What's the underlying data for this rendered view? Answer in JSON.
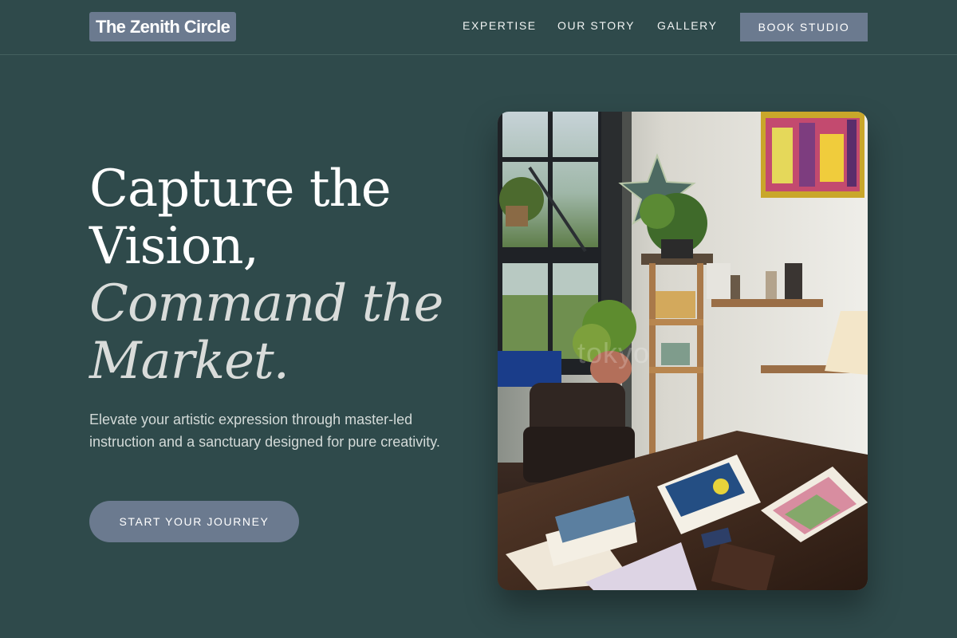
{
  "header": {
    "logo": "The Zenith Circle",
    "nav": [
      "EXPERTISE",
      "OUR STORY",
      "GALLERY"
    ],
    "cta": "BOOK STUDIO"
  },
  "hero": {
    "headline_lines": [
      "Capture the",
      "Vision,",
      "Command the",
      "Market."
    ],
    "subcopy": "Elevate your artistic expression through master-led instruction and a sanctuary designed for pure creativity.",
    "cta": "START YOUR JOURNEY"
  },
  "photo": {
    "watermark": "tokyo"
  },
  "colors": {
    "background": "#2f4a4b",
    "accent": "#6b7a8f",
    "text": "#ffffff"
  }
}
